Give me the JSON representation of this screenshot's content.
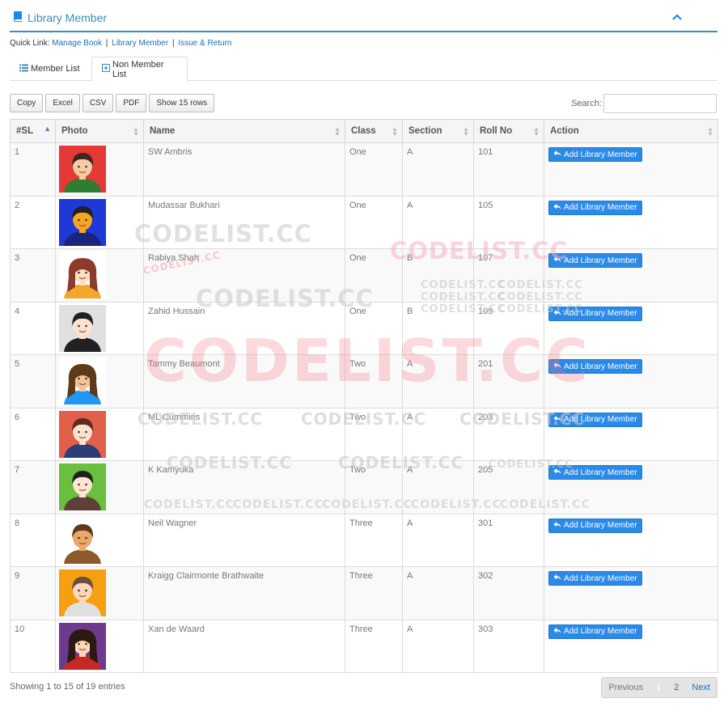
{
  "header": {
    "title": "Library Member",
    "book_icon": "book-icon",
    "collapse_icon": "chevron-up-icon"
  },
  "quick_link": {
    "label": "Quick Link:",
    "links": [
      "Manage Book",
      "Library Member",
      "Issue & Return"
    ],
    "separator": "|"
  },
  "tabs": [
    {
      "label": "Member List",
      "icon": "list-icon"
    },
    {
      "label": "Non Member List",
      "icon": "plus-square-icon",
      "active": true
    }
  ],
  "toolbar": {
    "buttons": [
      "Copy",
      "Excel",
      "CSV",
      "PDF",
      "Show 15 rows"
    ],
    "search_label": "Search:",
    "search_value": ""
  },
  "table": {
    "columns": [
      "#SL",
      "Photo",
      "Name",
      "Class",
      "Section",
      "Roll No",
      "Action"
    ],
    "sorted_column": "#SL",
    "action_label": "Add Library Member",
    "action_icon": "reply-icon",
    "rows": [
      {
        "sl": "1",
        "name": "SW Ambris",
        "class": "One",
        "section": "A",
        "roll": "101",
        "avatar_bg": "#e53935",
        "skin": "#f5cba7",
        "hair": "#3e2723",
        "shirt": "#2e7d32"
      },
      {
        "sl": "2",
        "name": "Mudassar Bukhari",
        "class": "One",
        "section": "A",
        "roll": "105",
        "avatar_bg": "#1e3ad6",
        "skin": "#f5a623",
        "hair": "#212121",
        "shirt": "#1a237e"
      },
      {
        "sl": "3",
        "name": "Rabiya Shah",
        "class": "One",
        "section": "B",
        "roll": "107",
        "avatar_bg": "#ffffff",
        "skin": "#fde0c5",
        "hair": "#8d3b2b",
        "shirt": "#f4a62a"
      },
      {
        "sl": "4",
        "name": "Zahid Hussain",
        "class": "One",
        "section": "B",
        "roll": "109",
        "avatar_bg": "#e0e0e0",
        "skin": "#fbe3d0",
        "hair": "#212121",
        "shirt": "#212121"
      },
      {
        "sl": "5",
        "name": "Tammy Beaumont",
        "class": "Two",
        "section": "A",
        "roll": "201",
        "avatar_bg": "#ffffff",
        "skin": "#f5c29b",
        "hair": "#5d3a1a",
        "shirt": "#2196f3"
      },
      {
        "sl": "6",
        "name": "ML Cummins",
        "class": "Two",
        "section": "A",
        "roll": "203",
        "avatar_bg": "#e1604a",
        "skin": "#fbe3d0",
        "hair": "#5d2c1a",
        "shirt": "#2c3e75"
      },
      {
        "sl": "7",
        "name": "K Kamyuka",
        "class": "Two",
        "section": "A",
        "roll": "205",
        "avatar_bg": "#6abf3f",
        "skin": "#fde7d3",
        "hair": "#212121",
        "shirt": "#5d4037"
      },
      {
        "sl": "8",
        "name": "Neil Wagner",
        "class": "Three",
        "section": "A",
        "roll": "301",
        "avatar_bg": "#ffffff",
        "skin": "#e8a86a",
        "hair": "#5d3a1a",
        "shirt": "#8d5a2b"
      },
      {
        "sl": "9",
        "name": "Kraigg Clairmonte Brathwaite",
        "class": "Three",
        "section": "A",
        "roll": "302",
        "avatar_bg": "#f4a010",
        "skin": "#fbd8b8",
        "hair": "#6d4c41",
        "shirt": "#e0e0e0"
      },
      {
        "sl": "10",
        "name": "Xan de Waard",
        "class": "Three",
        "section": "A",
        "roll": "303",
        "avatar_bg": "#6d3a8e",
        "skin": "#fbd8b8",
        "hair": "#2b1a12",
        "shirt": "#c62828"
      }
    ]
  },
  "footer": {
    "info": "Showing 1 to 15 of 19 entries",
    "pagination": {
      "previous": "Previous",
      "pages": [
        "1",
        "2"
      ],
      "current": "1",
      "next": "Next"
    }
  },
  "watermarks": [
    "CODELIST.CC"
  ],
  "colors": {
    "accent": "#3c8dbc",
    "action_button": "#2b8ae8",
    "watermark_grey": "#d8d8d8",
    "watermark_pink": "#f8c8d0"
  }
}
